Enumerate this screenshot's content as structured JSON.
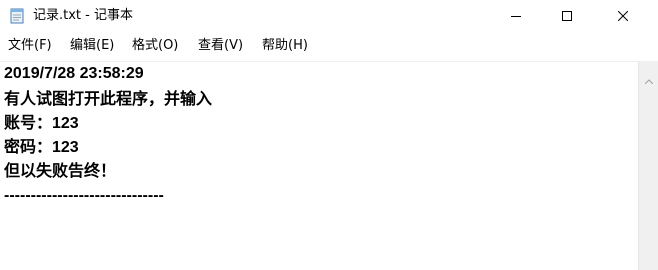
{
  "window": {
    "title": "记录.txt - 记事本"
  },
  "menu": {
    "file": "文件(F)",
    "edit": "编辑(E)",
    "format": "格式(O)",
    "view": "查看(V)",
    "help": "帮助(H)"
  },
  "editor": {
    "lines": [
      "2019/7/28 23:58:29",
      "有人试图打开此程序，并输入",
      "账号：123",
      "密码：123",
      "但以失败告终！",
      "------------------------------"
    ]
  },
  "icons": {
    "app": "notepad-icon",
    "minimize": "minimize-icon",
    "maximize": "maximize-icon",
    "close": "close-icon",
    "scroll_up": "scroll-up-arrow-icon"
  }
}
